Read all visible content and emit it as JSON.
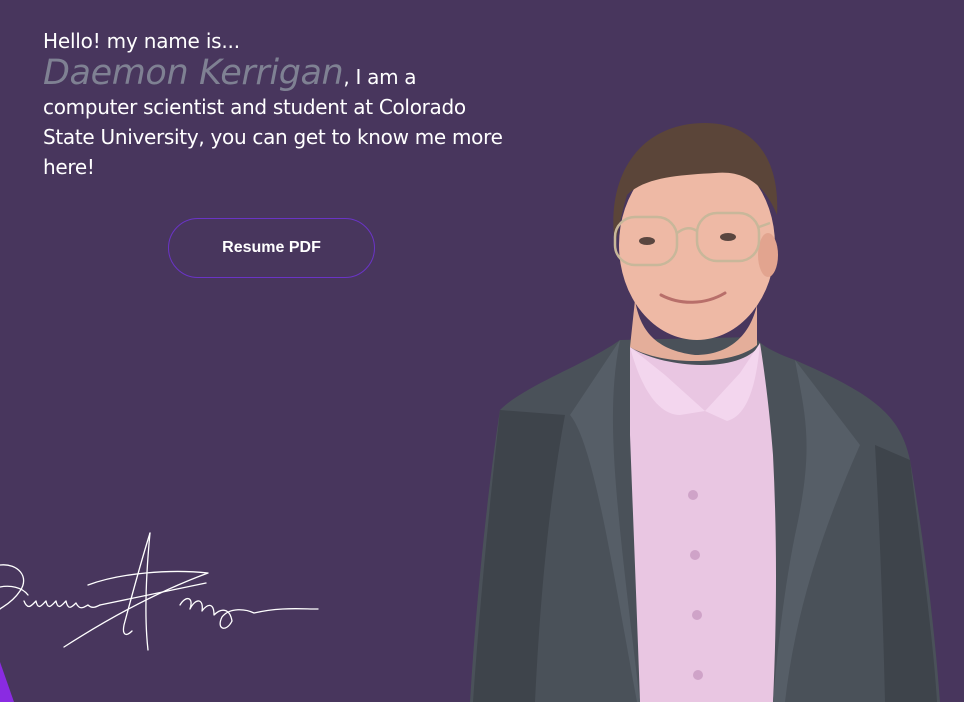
{
  "intro": {
    "greeting": "Hello! my name is...",
    "name": "Daemon Kerrigan",
    "bio": ", I am a computer scientist and student at Colorado State University, you can get to know me more here!"
  },
  "resume_button": {
    "label": "Resume PDF"
  },
  "colors": {
    "background": "#48365d",
    "name_text": "#7f8193",
    "button_border": "#6a34c6",
    "accent": "#8a2be2"
  }
}
